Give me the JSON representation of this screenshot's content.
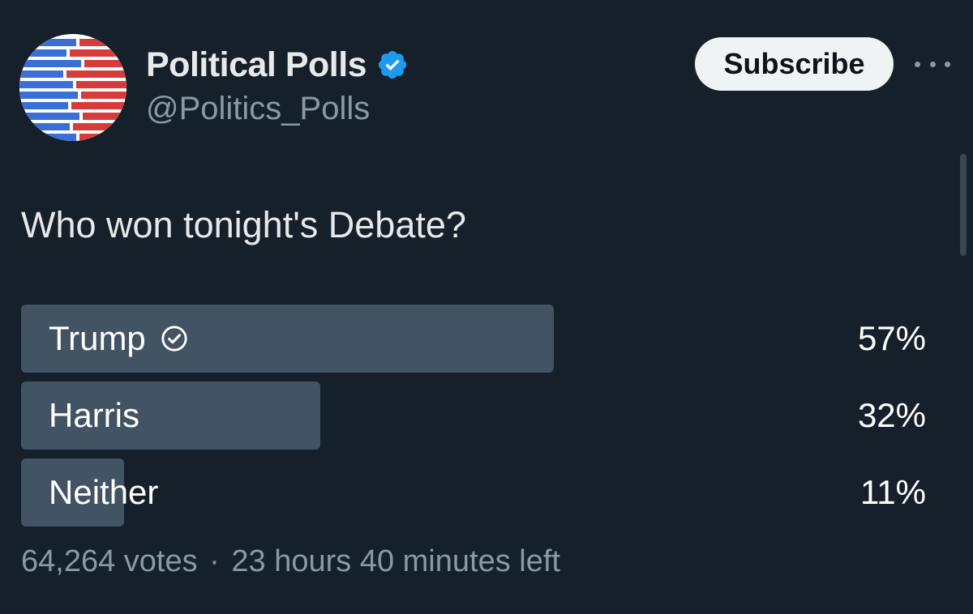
{
  "account": {
    "display_name": "Political Polls",
    "handle": "@Politics_Polls",
    "verified": true,
    "verified_icon": "verified-badge-icon",
    "avatar_colors": [
      "#3b6fd8",
      "#d63c3c",
      "#ffffff"
    ]
  },
  "actions": {
    "subscribe_label": "Subscribe",
    "more_icon": "more-options-icon"
  },
  "tweet": {
    "text": "Who won tonight's Debate?"
  },
  "poll": {
    "options": [
      {
        "label": "Trump",
        "percent_label": "57%",
        "percent": 57,
        "winner": true
      },
      {
        "label": "Harris",
        "percent_label": "32%",
        "percent": 32,
        "winner": false
      },
      {
        "label": "Neither",
        "percent_label": "11%",
        "percent": 11,
        "winner": false
      }
    ],
    "votes": "64,264 votes",
    "separator": "·",
    "time_left": "23 hours 40 minutes left",
    "bar_color": "#425364"
  },
  "colors": {
    "background": "#15202b",
    "verified": "#1d9bf0",
    "secondary_text": "#8b98a5"
  }
}
